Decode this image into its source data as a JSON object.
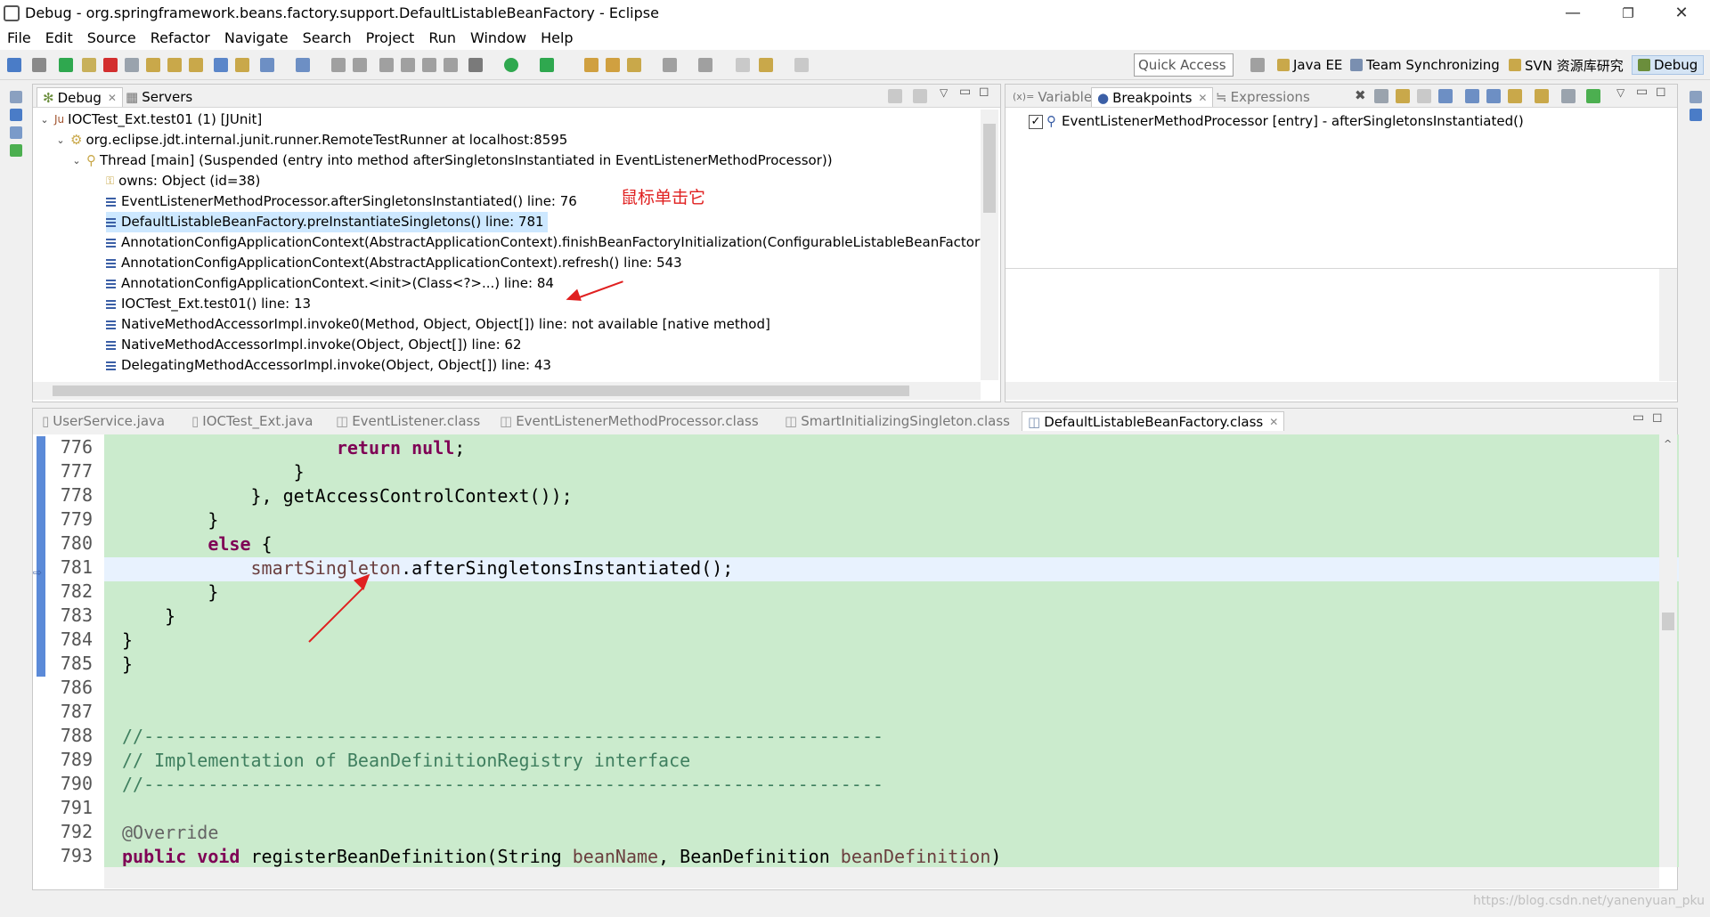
{
  "window": {
    "title": "Debug - org.springframework.beans.factory.support.DefaultListableBeanFactory - Eclipse",
    "minimize": "—",
    "maximize": "❐",
    "close": "✕"
  },
  "menu": [
    "File",
    "Edit",
    "Source",
    "Refactor",
    "Navigate",
    "Search",
    "Project",
    "Run",
    "Window",
    "Help"
  ],
  "toolbar": {
    "quick_access_placeholder": "Quick Access",
    "perspectives": [
      "Java EE",
      "Team Synchronizing",
      "SVN 资源库研究",
      "Debug"
    ]
  },
  "debug_view": {
    "tabs": [
      {
        "label": "Debug"
      },
      {
        "label": "Servers"
      }
    ],
    "rows": [
      {
        "text": "IOCTest_Ext.test01 (1) [JUnit]",
        "prefix": "Ju"
      },
      {
        "text": "org.eclipse.jdt.internal.junit.runner.RemoteTestRunner at localhost:8595"
      },
      {
        "text": "Thread [main] (Suspended (entry into method afterSingletonsInstantiated in EventListenerMethodProcessor))"
      },
      {
        "text": "owns: Object  (id=38)"
      },
      {
        "text": "EventListenerMethodProcessor.afterSingletonsInstantiated() line: 76"
      },
      {
        "text": "DefaultListableBeanFactory.preInstantiateSingletons() line: 781"
      },
      {
        "text": "AnnotationConfigApplicationContext(AbstractApplicationContext).finishBeanFactoryInitialization(ConfigurableListableBeanFactory) l"
      },
      {
        "text": "AnnotationConfigApplicationContext(AbstractApplicationContext).refresh() line: 543"
      },
      {
        "text": "AnnotationConfigApplicationContext.<init>(Class<?>...) line: 84"
      },
      {
        "text": "IOCTest_Ext.test01() line: 13"
      },
      {
        "text": "NativeMethodAccessorImpl.invoke0(Method, Object, Object[]) line: not available [native method]"
      },
      {
        "text": "NativeMethodAccessorImpl.invoke(Object, Object[]) line: 62"
      },
      {
        "text": "DelegatingMethodAccessorImpl.invoke(Object, Object[]) line: 43"
      }
    ],
    "annotation": "鼠标单击它"
  },
  "breakpoints_view": {
    "tabs": [
      {
        "label": "Variables"
      },
      {
        "label": "Breakpoints"
      },
      {
        "label": "Expressions"
      }
    ],
    "items": [
      {
        "text": "EventListenerMethodProcessor [entry] - afterSingletonsInstantiated()",
        "checked": true
      }
    ]
  },
  "editor": {
    "tabs": [
      {
        "label": "UserService.java"
      },
      {
        "label": "IOCTest_Ext.java"
      },
      {
        "label": "EventListener.class"
      },
      {
        "label": "EventListenerMethodProcessor.class"
      },
      {
        "label": "SmartInitializingSingleton.class"
      },
      {
        "label": "DefaultListableBeanFactory.class"
      }
    ],
    "line_numbers": [
      "776",
      "777",
      "778",
      "779",
      "780",
      "781",
      "782",
      "783",
      "784",
      "785",
      "786",
      "787",
      "788",
      "789",
      "790",
      "791",
      "792",
      "793"
    ],
    "lines": [
      "                    return null;",
      "                }",
      "            }, getAccessControlContext());",
      "        }",
      "        else {",
      "            smartSingleton.afterSingletonsInstantiated();",
      "        }",
      "    }",
      "}",
      "}",
      "",
      "",
      "//---------------------------------------------------------------------",
      "// Implementation of BeanDefinitionRegistry interface",
      "//---------------------------------------------------------------------",
      "",
      "@Override",
      "public void registerBeanDefinition(String beanName, BeanDefinition beanDefinition)"
    ]
  },
  "watermark": "https://blog.csdn.net/yanenyuan_pku",
  "colors": {
    "editor_bg": "#cbebcd",
    "current_line": "#e8f2fe",
    "selection": "#cde8ff",
    "annotation": "#e02020"
  }
}
